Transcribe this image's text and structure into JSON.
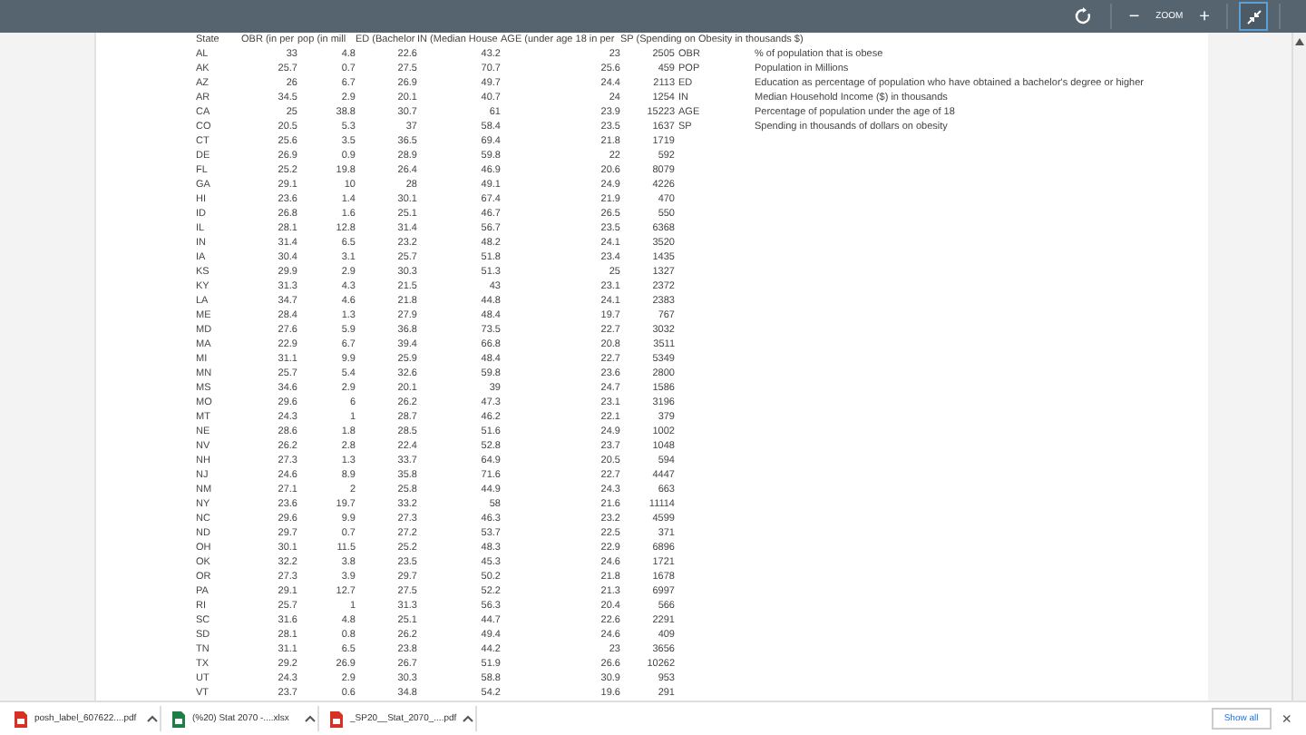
{
  "toolbar": {
    "zoom_out": "−",
    "zoom_label": "ZOOM",
    "zoom_in": "+"
  },
  "sheet": {
    "columns": [
      "State",
      "OBR (in per",
      "pop (in mill",
      "ED (Bachelor",
      "IN (Median House",
      "AGE (under age 18 in per",
      "SP (Spending on Obesity in thousands $)"
    ],
    "rows": [
      [
        "AL",
        "33",
        "4.8",
        "22.6",
        "43.2",
        "23",
        "2505"
      ],
      [
        "AK",
        "25.7",
        "0.7",
        "27.5",
        "70.7",
        "25.6",
        "459"
      ],
      [
        "AZ",
        "26",
        "6.7",
        "26.9",
        "49.7",
        "24.4",
        "2113"
      ],
      [
        "AR",
        "34.5",
        "2.9",
        "20.1",
        "40.7",
        "24",
        "1254"
      ],
      [
        "CA",
        "25",
        "38.8",
        "30.7",
        "61",
        "23.9",
        "15223"
      ],
      [
        "CO",
        "20.5",
        "5.3",
        "37",
        "58.4",
        "23.5",
        "1637"
      ],
      [
        "CT",
        "25.6",
        "3.5",
        "36.5",
        "69.4",
        "21.8",
        "1719"
      ],
      [
        "DE",
        "26.9",
        "0.9",
        "28.9",
        "59.8",
        "22",
        "592"
      ],
      [
        "FL",
        "25.2",
        "19.8",
        "26.4",
        "46.9",
        "20.6",
        "8079"
      ],
      [
        "GA",
        "29.1",
        "10",
        "28",
        "49.1",
        "24.9",
        "4226"
      ],
      [
        "HI",
        "23.6",
        "1.4",
        "30.1",
        "67.4",
        "21.9",
        "470"
      ],
      [
        "ID",
        "26.8",
        "1.6",
        "25.1",
        "46.7",
        "26.5",
        "550"
      ],
      [
        "IL",
        "28.1",
        "12.8",
        "31.4",
        "56.7",
        "23.5",
        "6368"
      ],
      [
        "IN",
        "31.4",
        "6.5",
        "23.2",
        "48.2",
        "24.1",
        "3520"
      ],
      [
        "IA",
        "30.4",
        "3.1",
        "25.7",
        "51.8",
        "23.4",
        "1435"
      ],
      [
        "KS",
        "29.9",
        "2.9",
        "30.3",
        "51.3",
        "25",
        "1327"
      ],
      [
        "KY",
        "31.3",
        "4.3",
        "21.5",
        "43",
        "23.1",
        "2372"
      ],
      [
        "LA",
        "34.7",
        "4.6",
        "21.8",
        "44.8",
        "24.1",
        "2383"
      ],
      [
        "ME",
        "28.4",
        "1.3",
        "27.9",
        "48.4",
        "19.7",
        "767"
      ],
      [
        "MD",
        "27.6",
        "5.9",
        "36.8",
        "73.5",
        "22.7",
        "3032"
      ],
      [
        "MA",
        "22.9",
        "6.7",
        "39.4",
        "66.8",
        "20.8",
        "3511"
      ],
      [
        "MI",
        "31.1",
        "9.9",
        "25.9",
        "48.4",
        "22.7",
        "5349"
      ],
      [
        "MN",
        "25.7",
        "5.4",
        "32.6",
        "59.8",
        "23.6",
        "2800"
      ],
      [
        "MS",
        "34.6",
        "2.9",
        "20.1",
        "39",
        "24.7",
        "1586"
      ],
      [
        "MO",
        "29.6",
        "6",
        "26.2",
        "47.3",
        "23.1",
        "3196"
      ],
      [
        "MT",
        "24.3",
        "1",
        "28.7",
        "46.2",
        "22.1",
        "379"
      ],
      [
        "NE",
        "28.6",
        "1.8",
        "28.5",
        "51.6",
        "24.9",
        "1002"
      ],
      [
        "NV",
        "26.2",
        "2.8",
        "22.4",
        "52.8",
        "23.7",
        "1048"
      ],
      [
        "NH",
        "27.3",
        "1.3",
        "33.7",
        "64.9",
        "20.5",
        "594"
      ],
      [
        "NJ",
        "24.6",
        "8.9",
        "35.8",
        "71.6",
        "22.7",
        "4447"
      ],
      [
        "NM",
        "27.1",
        "2",
        "25.8",
        "44.9",
        "24.3",
        "663"
      ],
      [
        "NY",
        "23.6",
        "19.7",
        "33.2",
        "58",
        "21.6",
        "11114"
      ],
      [
        "NC",
        "29.6",
        "9.9",
        "27.3",
        "46.3",
        "23.2",
        "4599"
      ],
      [
        "ND",
        "29.7",
        "0.7",
        "27.2",
        "53.7",
        "22.5",
        "371"
      ],
      [
        "OH",
        "30.1",
        "11.5",
        "25.2",
        "48.3",
        "22.9",
        "6896"
      ],
      [
        "OK",
        "32.2",
        "3.8",
        "23.5",
        "45.3",
        "24.6",
        "1721"
      ],
      [
        "OR",
        "27.3",
        "3.9",
        "29.7",
        "50.2",
        "21.8",
        "1678"
      ],
      [
        "PA",
        "29.1",
        "12.7",
        "27.5",
        "52.2",
        "21.3",
        "6997"
      ],
      [
        "RI",
        "25.7",
        "1",
        "31.3",
        "56.3",
        "20.4",
        "566"
      ],
      [
        "SC",
        "31.6",
        "4.8",
        "25.1",
        "44.7",
        "22.6",
        "2291"
      ],
      [
        "SD",
        "28.1",
        "0.8",
        "26.2",
        "49.4",
        "24.6",
        "409"
      ],
      [
        "TN",
        "31.1",
        "6.5",
        "23.8",
        "44.2",
        "23",
        "3656"
      ],
      [
        "TX",
        "29.2",
        "26.9",
        "26.7",
        "51.9",
        "26.6",
        "10262"
      ],
      [
        "UT",
        "24.3",
        "2.9",
        "30.3",
        "58.8",
        "30.9",
        "953"
      ],
      [
        "VT",
        "23.7",
        "0.6",
        "34.8",
        "54.2",
        "19.6",
        "291"
      ]
    ],
    "legend": [
      {
        "code": "OBR",
        "description": "% of population that is obese"
      },
      {
        "code": "POP",
        "description": "Population in Millions"
      },
      {
        "code": "ED",
        "description": "Education as percentage of population who have obtained a bachelor's degree or higher"
      },
      {
        "code": "IN",
        "description": "Median Household Income ($) in thousands"
      },
      {
        "code": "AGE",
        "description": "Percentage of population under the age of 18"
      },
      {
        "code": "SP",
        "description": "Spending in thousands of dollars on obesity"
      }
    ]
  },
  "downloads": [
    {
      "name": "posh_label_607622....pdf",
      "kind": "pdf"
    },
    {
      "name": "(%20) Stat 2070 -....xlsx",
      "kind": "xlsx"
    },
    {
      "name": "_SP20__Stat_2070_....pdf",
      "kind": "pdf"
    }
  ],
  "show_all": "Show all",
  "close": "×"
}
